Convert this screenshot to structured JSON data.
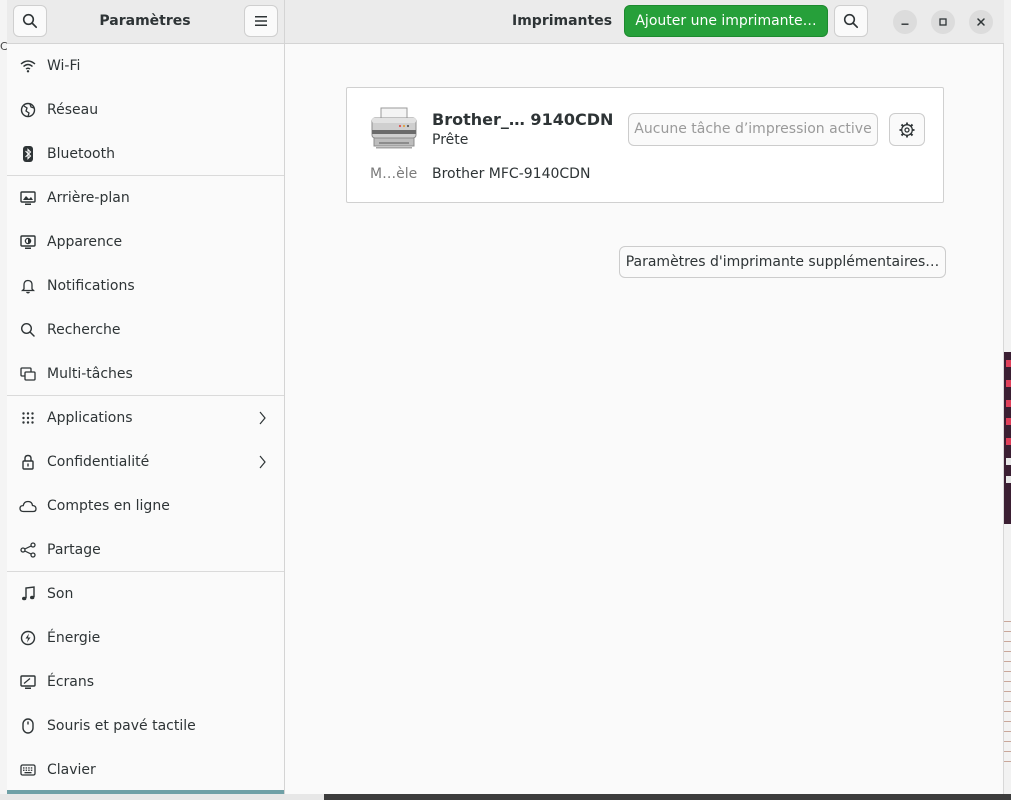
{
  "sidebar": {
    "title": "Paramètres",
    "items": [
      {
        "label": "Wi-Fi",
        "icon": "wifi-icon"
      },
      {
        "label": "Réseau",
        "icon": "network-icon"
      },
      {
        "label": "Bluetooth",
        "icon": "bluetooth-icon"
      },
      {
        "label": "Arrière-plan",
        "icon": "background-icon"
      },
      {
        "label": "Apparence",
        "icon": "appearance-icon"
      },
      {
        "label": "Notifications",
        "icon": "bell-icon"
      },
      {
        "label": "Recherche",
        "icon": "search-icon"
      },
      {
        "label": "Multi-tâches",
        "icon": "multitasking-icon"
      },
      {
        "label": "Applications",
        "icon": "apps-grid-icon",
        "submenu": true
      },
      {
        "label": "Confidentialité",
        "icon": "lock-icon",
        "submenu": true
      },
      {
        "label": "Comptes en ligne",
        "icon": "cloud-icon"
      },
      {
        "label": "Partage",
        "icon": "share-icon"
      },
      {
        "label": "Son",
        "icon": "music-note-icon"
      },
      {
        "label": "Énergie",
        "icon": "power-icon"
      },
      {
        "label": "Écrans",
        "icon": "display-icon"
      },
      {
        "label": "Souris et pavé tactile",
        "icon": "mouse-icon"
      },
      {
        "label": "Clavier",
        "icon": "keyboard-icon"
      }
    ]
  },
  "header": {
    "title": "Imprimantes",
    "add_printer_label": "Ajouter une imprimante…",
    "accent": "#26a03a"
  },
  "printer": {
    "name": "Brother_… 9140CDN",
    "state": "Prête",
    "jobs_label": "Aucune tâche d’impression active",
    "model_label": "M…èle",
    "model_value": "Brother MFC-9140CDN"
  },
  "extra_settings_label": "Paramètres d'imprimante supplémentaires…",
  "background": {
    "left_edge_char": "C"
  }
}
